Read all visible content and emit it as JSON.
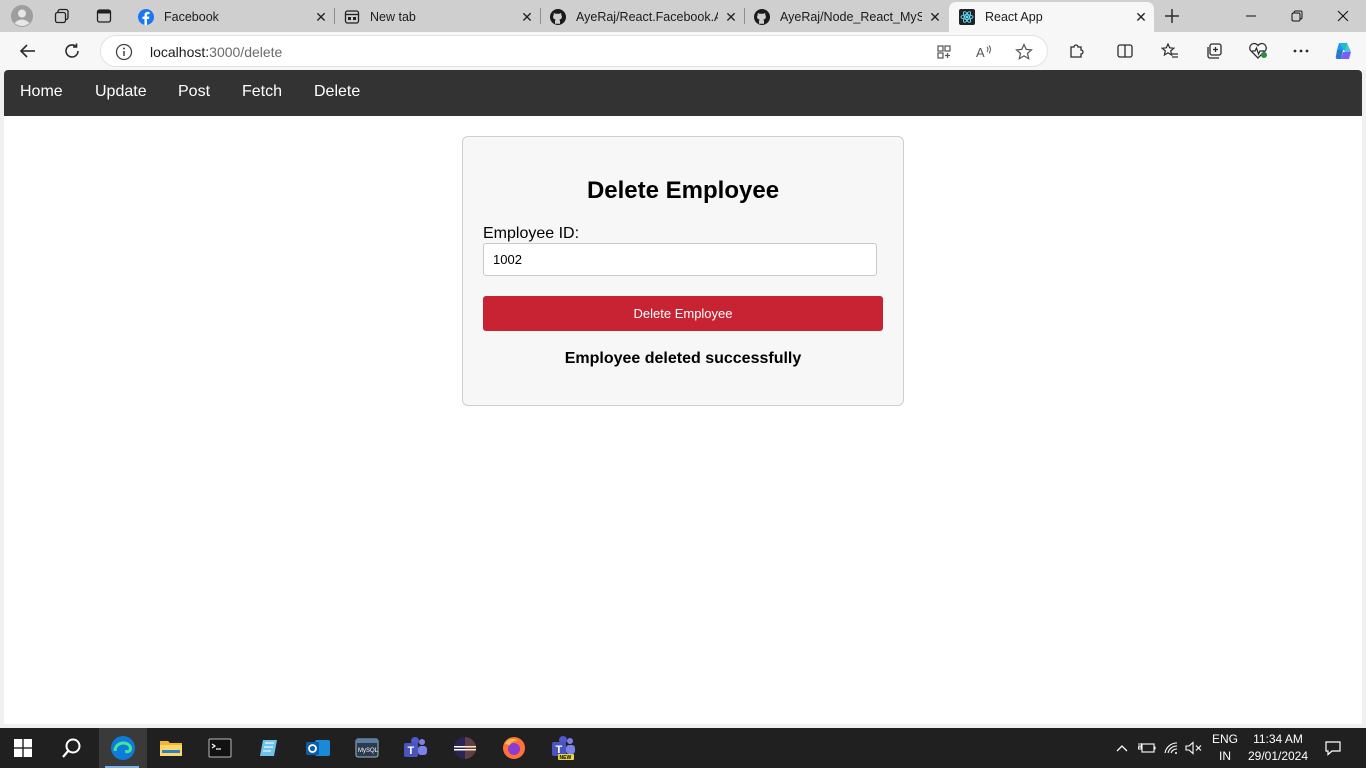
{
  "browser": {
    "tabs": [
      {
        "title": "Facebook",
        "favicon": "facebook-icon",
        "active": false
      },
      {
        "title": "New tab",
        "favicon": "new-tab-icon",
        "active": false
      },
      {
        "title": "AyeRaj/React.Facebook.Ap",
        "favicon": "github-icon",
        "active": false
      },
      {
        "title": "AyeRaj/Node_React_MySQ",
        "favicon": "github-icon",
        "active": false
      },
      {
        "title": "React App",
        "favicon": "react-icon",
        "active": true
      }
    ],
    "address": {
      "host": "localhost:",
      "path": "3000/delete"
    }
  },
  "app": {
    "nav": {
      "home": "Home",
      "update": "Update",
      "post": "Post",
      "fetch": "Fetch",
      "delete": "Delete"
    },
    "form": {
      "title": "Delete Employee",
      "id_label": "Employee ID:",
      "id_value": "1002",
      "button_label": "Delete Employee",
      "status_message": "Employee deleted successfully"
    }
  },
  "taskbar": {
    "language": "ENG",
    "region": "IN",
    "time": "11:34 AM",
    "date": "29/01/2024"
  },
  "colors": {
    "navbar_bg": "#333333",
    "delete_button": "#c82333",
    "card_bg": "#f7f7f7",
    "tabstrip_bg": "#cfcfcf",
    "taskbar_bg": "#202020"
  }
}
